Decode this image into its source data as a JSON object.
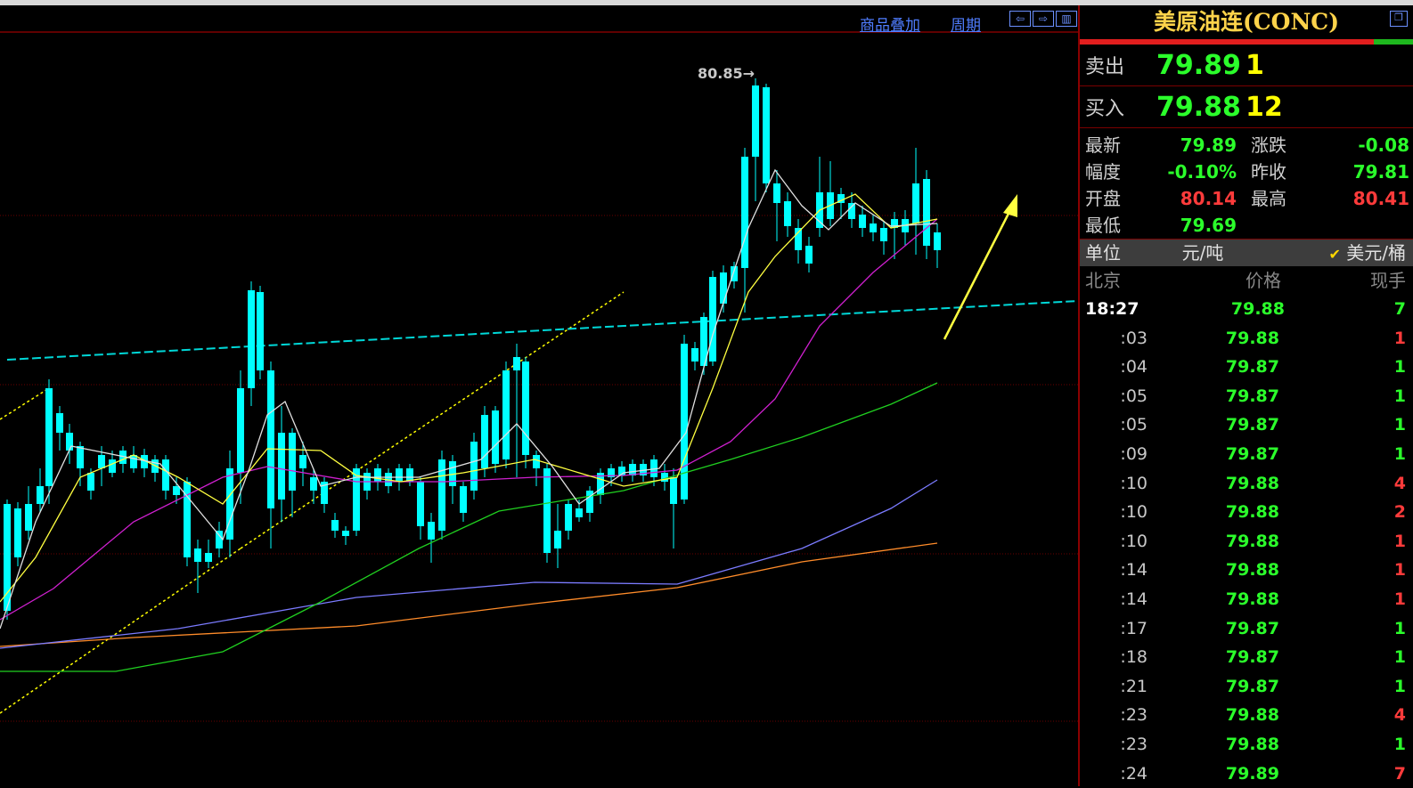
{
  "chart_header": {
    "overlay_label": "商品叠加",
    "period_label": "周期",
    "nav_icons": [
      "left-arrow-icon",
      "right-arrow-icon",
      "panel-toggle-icon"
    ]
  },
  "chart_data": {
    "type": "candlestick",
    "high_marker": "80.85",
    "colors": {
      "up": "#ff3b3b",
      "down": "#00ffff",
      "ma5": "#e0e0e0",
      "ma10": "#ffff40",
      "ma20": "#d020d0",
      "ma60": "#20d020",
      "ma120": "#7b7bff",
      "ma250": "#ff8c2a",
      "trend": "#00d8d8",
      "channel": "#ffff00",
      "arrow": "#ffff40"
    }
  },
  "panel": {
    "title": "美原油连(CONC)",
    "sell": {
      "label": "卖出",
      "price": "79.89",
      "volume": "1"
    },
    "buy": {
      "label": "买入",
      "price": "79.88",
      "volume": "12"
    },
    "stats": [
      {
        "label": "最新",
        "value": "79.89",
        "color": "green",
        "label2": "涨跌",
        "value2": "-0.08",
        "color2": "green"
      },
      {
        "label": "幅度",
        "value": "-0.10%",
        "color": "green",
        "label2": "昨收",
        "value2": "79.81",
        "color2": "green"
      },
      {
        "label": "开盘",
        "value": "80.14",
        "color": "red",
        "label2": "最高",
        "value2": "80.41",
        "color2": "red"
      },
      {
        "label": "最低",
        "value": "79.69",
        "color": "green",
        "label2": "",
        "value2": "",
        "color2": "green"
      }
    ],
    "unit": {
      "label": "单位",
      "cny": "元/吨",
      "usd": "美元/桶"
    },
    "tick_header": {
      "time": "北京",
      "price": "价格",
      "volume": "现手"
    },
    "ticks": [
      {
        "time": "18:27",
        "price": "79.88",
        "volume": "7",
        "dir": "green"
      },
      {
        "time": ":03",
        "price": "79.88",
        "volume": "1",
        "dir": "red"
      },
      {
        "time": ":04",
        "price": "79.87",
        "volume": "1",
        "dir": "green"
      },
      {
        "time": ":05",
        "price": "79.87",
        "volume": "1",
        "dir": "green"
      },
      {
        "time": ":05",
        "price": "79.87",
        "volume": "1",
        "dir": "green"
      },
      {
        "time": ":09",
        "price": "79.87",
        "volume": "1",
        "dir": "green"
      },
      {
        "time": ":10",
        "price": "79.88",
        "volume": "4",
        "dir": "red"
      },
      {
        "time": ":10",
        "price": "79.88",
        "volume": "2",
        "dir": "red"
      },
      {
        "time": ":10",
        "price": "79.88",
        "volume": "1",
        "dir": "red"
      },
      {
        "time": ":14",
        "price": "79.88",
        "volume": "1",
        "dir": "red"
      },
      {
        "time": ":14",
        "price": "79.88",
        "volume": "1",
        "dir": "red"
      },
      {
        "time": ":17",
        "price": "79.87",
        "volume": "1",
        "dir": "green"
      },
      {
        "time": ":18",
        "price": "79.87",
        "volume": "1",
        "dir": "green"
      },
      {
        "time": ":21",
        "price": "79.87",
        "volume": "1",
        "dir": "green"
      },
      {
        "time": ":23",
        "price": "79.88",
        "volume": "4",
        "dir": "red"
      },
      {
        "time": ":23",
        "price": "79.88",
        "volume": "1",
        "dir": "green"
      },
      {
        "time": ":24",
        "price": "79.89",
        "volume": "7",
        "dir": "red"
      }
    ]
  }
}
